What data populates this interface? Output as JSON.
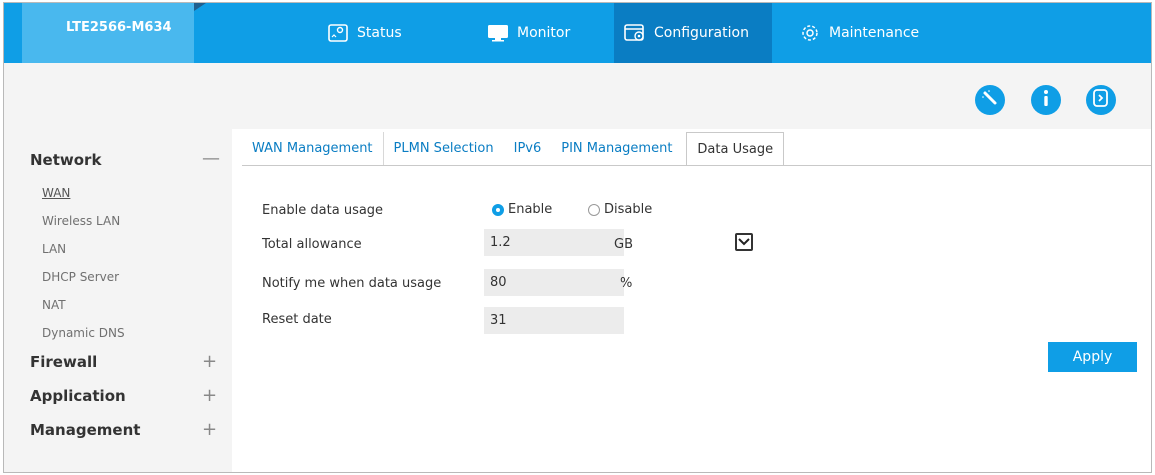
{
  "app": {
    "model": "LTE2566-M634"
  },
  "nav": [
    {
      "label": "Status",
      "icon": "status-icon"
    },
    {
      "label": "Monitor",
      "icon": "monitor-icon"
    },
    {
      "label": "Configuration",
      "icon": "configuration-icon",
      "active": true
    },
    {
      "label": "Maintenance",
      "icon": "maintenance-icon"
    }
  ],
  "actions": [
    {
      "icon": "wizard-icon"
    },
    {
      "icon": "info-icon"
    },
    {
      "icon": "logout-icon"
    }
  ],
  "sidebar": {
    "groups": [
      {
        "label": "Network",
        "toggle": "—",
        "expanded": true
      },
      {
        "label": "Firewall",
        "toggle": "+"
      },
      {
        "label": "Application",
        "toggle": "+"
      },
      {
        "label": "Management",
        "toggle": "+"
      }
    ],
    "network_items": [
      "WAN",
      "Wireless LAN",
      "LAN",
      "DHCP Server",
      "NAT",
      "Dynamic DNS"
    ]
  },
  "tabs": [
    "WAN Management",
    "PLMN Selection",
    "IPv6",
    "PIN Management",
    "Data Usage"
  ],
  "form": {
    "enable_label": "Enable data usage",
    "enable_option": "Enable",
    "disable_option": "Disable",
    "enable_selected": true,
    "allowance_label": "Total allowance",
    "allowance_value": "1.2",
    "allowance_unit": "GB",
    "notify_label": "Notify me when data usage",
    "notify_value": "80",
    "notify_unit": "%",
    "reset_label": "Reset date",
    "reset_value": "31",
    "apply_label": "Apply"
  },
  "colors": {
    "accent": "#0f9ee6",
    "active_nav": "#0a7dc3",
    "brand_tab": "#49b8ee"
  }
}
